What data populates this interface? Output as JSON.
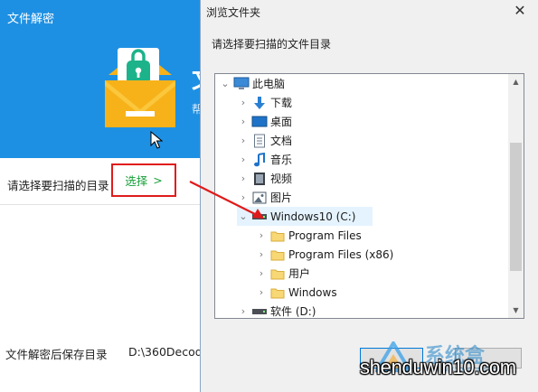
{
  "app": {
    "title": "文件解密",
    "header_partial_big": "文",
    "header_partial_small": "帮",
    "scan_label": "请选择要扫描的目录",
    "select_button": {
      "label": "选择",
      "chevron": ">"
    },
    "save_label": "文件解密后保存目录",
    "save_path": "D:\\360Decod"
  },
  "dialog": {
    "title": "浏览文件夹",
    "close": "✕",
    "prompt": "请选择要扫描的文件目录",
    "tree": [
      {
        "label": "此电脑",
        "icon": "computer-icon",
        "expanded": true
      },
      {
        "label": "下载",
        "icon": "download-folder-icon"
      },
      {
        "label": "桌面",
        "icon": "desktop-folder-icon"
      },
      {
        "label": "文档",
        "icon": "documents-folder-icon"
      },
      {
        "label": "音乐",
        "icon": "music-folder-icon"
      },
      {
        "label": "视频",
        "icon": "video-folder-icon"
      },
      {
        "label": "图片",
        "icon": "pictures-folder-icon"
      },
      {
        "label": "Windows10 (C:)",
        "icon": "drive-icon",
        "expanded": true,
        "selected": true
      },
      {
        "label": "Program Files",
        "icon": "folder-icon"
      },
      {
        "label": "Program Files (x86)",
        "icon": "folder-icon"
      },
      {
        "label": "用户",
        "icon": "folder-icon"
      },
      {
        "label": "Windows",
        "icon": "folder-icon"
      },
      {
        "label": "软件 (D:)",
        "icon": "drive-icon"
      }
    ]
  },
  "watermark": {
    "main": "shenduwin10.com",
    "site": "系统盒",
    "site_small": "www.xitonghe.com"
  },
  "colors": {
    "header_blue": "#1e90e3",
    "select_green": "#18a03a",
    "annotation_red": "#e01b1b",
    "selection_bg": "#e5f3ff"
  }
}
